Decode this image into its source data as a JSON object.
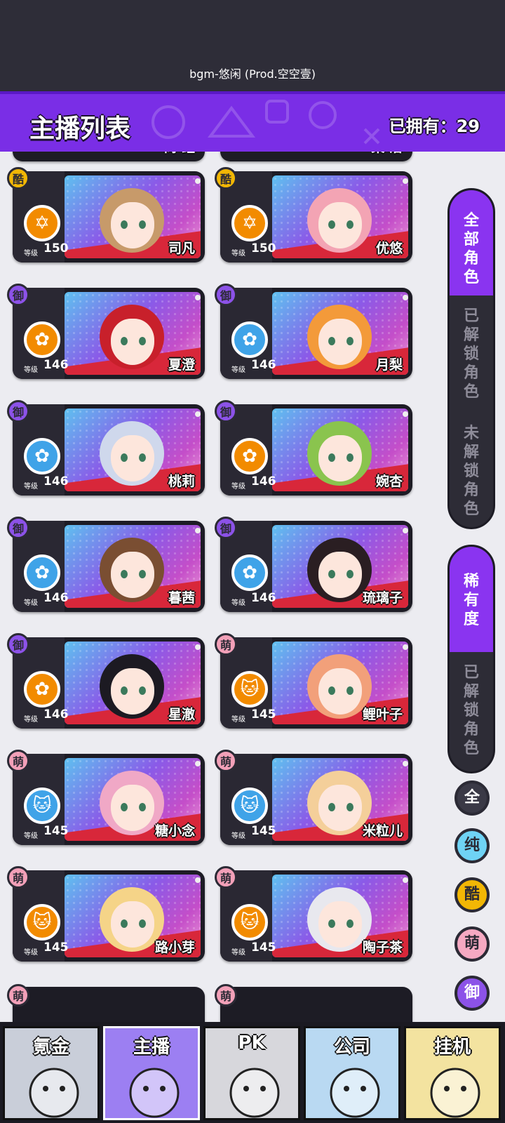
{
  "top": {
    "bgm_text": "bgm-悠闲 (Prod.空空壹)"
  },
  "header": {
    "title": "主播列表",
    "owned_label": "已拥有：29"
  },
  "partial_top": [
    {
      "name": "尚 鲤"
    },
    {
      "name": "某 洁"
    }
  ],
  "cards": [
    {
      "rarity": "酷",
      "rarity_color": "#f2b705",
      "medal_color": "#f28b00",
      "medal_glyph": "✡",
      "level_label": "等级",
      "level": "150",
      "name": "司凡",
      "hair": "#c79a6a"
    },
    {
      "rarity": "酷",
      "rarity_color": "#f2b705",
      "medal_color": "#f28b00",
      "medal_glyph": "✡",
      "level_label": "等级",
      "level": "150",
      "name": "优悠",
      "hair": "#f3a4b4"
    },
    {
      "rarity": "御",
      "rarity_color": "#8c52e8",
      "medal_color": "#f28b00",
      "medal_glyph": "✿",
      "level_label": "等级",
      "level": "146",
      "name": "夏澄",
      "hair": "#c8202b"
    },
    {
      "rarity": "御",
      "rarity_color": "#8c52e8",
      "medal_color": "#3fa3e8",
      "medal_glyph": "✿",
      "level_label": "等级",
      "level": "146",
      "name": "月梨",
      "hair": "#f39a3a"
    },
    {
      "rarity": "御",
      "rarity_color": "#8c52e8",
      "medal_color": "#3fa3e8",
      "medal_glyph": "✿",
      "level_label": "等级",
      "level": "146",
      "name": "桃莉",
      "hair": "#cfd8ec"
    },
    {
      "rarity": "御",
      "rarity_color": "#8c52e8",
      "medal_color": "#f28b00",
      "medal_glyph": "✿",
      "level_label": "等级",
      "level": "146",
      "name": "婉杏",
      "hair": "#8ac44e"
    },
    {
      "rarity": "御",
      "rarity_color": "#8c52e8",
      "medal_color": "#3fa3e8",
      "medal_glyph": "✿",
      "level_label": "等级",
      "level": "146",
      "name": "暮茜",
      "hair": "#7a4e32"
    },
    {
      "rarity": "御",
      "rarity_color": "#8c52e8",
      "medal_color": "#3fa3e8",
      "medal_glyph": "✿",
      "level_label": "等级",
      "level": "146",
      "name": "琉璃子",
      "hair": "#2a1e22"
    },
    {
      "rarity": "御",
      "rarity_color": "#8c52e8",
      "medal_color": "#f28b00",
      "medal_glyph": "✿",
      "level_label": "等级",
      "level": "146",
      "name": "星澈",
      "hair": "#1c1a22"
    },
    {
      "rarity": "萌",
      "rarity_color": "#f2a0b8",
      "medal_color": "#f28b00",
      "medal_glyph": "🐱",
      "level_label": "等级",
      "level": "145",
      "name": "鲤叶子",
      "hair": "#f2a07a"
    },
    {
      "rarity": "萌",
      "rarity_color": "#f2a0b8",
      "medal_color": "#3fa3e8",
      "medal_glyph": "🐱",
      "level_label": "等级",
      "level": "145",
      "name": "糖小念",
      "hair": "#f0a8c6"
    },
    {
      "rarity": "萌",
      "rarity_color": "#f2a0b8",
      "medal_color": "#3fa3e8",
      "medal_glyph": "🐱",
      "level_label": "等级",
      "level": "145",
      "name": "米粒儿",
      "hair": "#f4cf9a"
    },
    {
      "rarity": "萌",
      "rarity_color": "#f2a0b8",
      "medal_color": "#f28b00",
      "medal_glyph": "🐱",
      "level_label": "等级",
      "level": "145",
      "name": "路小芽",
      "hair": "#f5d488"
    },
    {
      "rarity": "萌",
      "rarity_color": "#f2a0b8",
      "medal_color": "#f28b00",
      "medal_glyph": "🐱",
      "level_label": "等级",
      "level": "145",
      "name": "陶子茶",
      "hair": "#e8e8ee"
    }
  ],
  "partial_bottom": [
    {
      "rarity": "萌"
    },
    {
      "rarity": "萌"
    }
  ],
  "side_menu_1": [
    {
      "label": "全部角色",
      "active": true
    },
    {
      "label": "已解锁角色",
      "active": false
    },
    {
      "label": "未解锁角色",
      "active": false
    }
  ],
  "side_menu_2": [
    {
      "label": "稀有度",
      "active": true
    },
    {
      "label": "已解锁角色",
      "active": false
    }
  ],
  "filters": [
    {
      "label": "全",
      "color": "#3a3946",
      "text_color": "#ffffff"
    },
    {
      "label": "纯",
      "color": "#6fd3f5",
      "text_color": "#2b2a35"
    },
    {
      "label": "酷",
      "color": "#f2b705",
      "text_color": "#2b2a35"
    },
    {
      "label": "萌",
      "color": "#f5a9c2",
      "text_color": "#2b2a35"
    },
    {
      "label": "御",
      "color": "#8c52e8",
      "text_color": "#ffffff"
    }
  ],
  "bottom_tabs": [
    {
      "label": "氪金",
      "bg": "#c9ced9",
      "active": false
    },
    {
      "label": "主播",
      "bg": "#9c7ff2",
      "active": true
    },
    {
      "label": "PK",
      "bg": "#d7d7dc",
      "active": false
    },
    {
      "label": "公司",
      "bg": "#b9d9f2",
      "active": false
    },
    {
      "label": "挂机",
      "bg": "#f3e3a0",
      "active": false
    }
  ]
}
